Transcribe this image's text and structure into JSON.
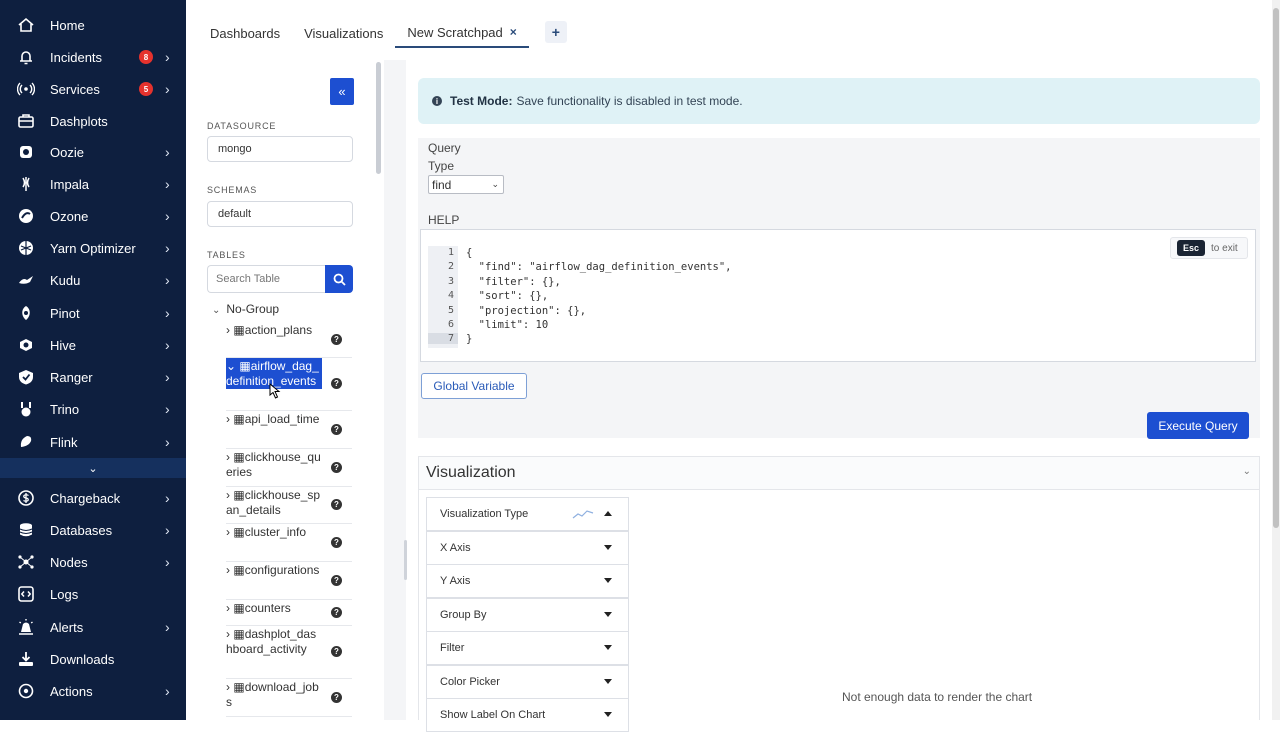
{
  "nav": {
    "items": [
      {
        "label": "Home",
        "icon": "home-icon",
        "badge": "",
        "chevron": false
      },
      {
        "label": "Incidents",
        "icon": "bell-icon",
        "badge": "8",
        "chevron": true
      },
      {
        "label": "Services",
        "icon": "broadcast-icon",
        "badge": "5",
        "chevron": true
      },
      {
        "label": "Dashplots",
        "icon": "briefcase-icon",
        "badge": "",
        "chevron": false
      },
      {
        "label": "Oozie",
        "icon": "oozie-icon",
        "badge": "",
        "chevron": true
      },
      {
        "label": "Impala",
        "icon": "impala-icon",
        "badge": "",
        "chevron": true
      },
      {
        "label": "Ozone",
        "icon": "ozone-icon",
        "badge": "",
        "chevron": true
      },
      {
        "label": "Yarn Optimizer",
        "icon": "yarn-icon",
        "badge": "",
        "chevron": true
      },
      {
        "label": "Kudu",
        "icon": "kudu-icon",
        "badge": "",
        "chevron": true
      },
      {
        "label": "Pinot",
        "icon": "pinot-icon",
        "badge": "",
        "chevron": true
      },
      {
        "label": "Hive",
        "icon": "hive-icon",
        "badge": "",
        "chevron": true
      },
      {
        "label": "Ranger",
        "icon": "ranger-icon",
        "badge": "",
        "chevron": true
      },
      {
        "label": "Trino",
        "icon": "trino-icon",
        "badge": "",
        "chevron": true
      },
      {
        "label": "Flink",
        "icon": "flink-icon",
        "badge": "",
        "chevron": true
      },
      {
        "label": "Chargeback",
        "icon": "dollar-icon",
        "badge": "",
        "chevron": true
      },
      {
        "label": "Databases",
        "icon": "database-icon",
        "badge": "",
        "chevron": true
      },
      {
        "label": "Nodes",
        "icon": "nodes-icon",
        "badge": "",
        "chevron": true
      },
      {
        "label": "Logs",
        "icon": "code-icon",
        "badge": "",
        "chevron": false
      },
      {
        "label": "Alerts",
        "icon": "alert-icon",
        "badge": "",
        "chevron": true
      },
      {
        "label": "Downloads",
        "icon": "download-icon",
        "badge": "",
        "chevron": false
      },
      {
        "label": "Actions",
        "icon": "actions-icon",
        "badge": "",
        "chevron": true
      }
    ],
    "expand_icon": "chevron-down-icon"
  },
  "tabs": {
    "items": [
      "Dashboards",
      "Visualizations",
      "New Scratchpad"
    ],
    "close": "×",
    "add": "+"
  },
  "sidebar": {
    "collapse_glyph": "«",
    "datasource_label": "DATASOURCE",
    "datasource_value": "mongo",
    "schemas_label": "SCHEMAS",
    "schemas_value": "default",
    "tables_label": "TABLES",
    "search_placeholder": "Search Table",
    "group": "No-Group",
    "tables": [
      "action_plans",
      "airflow_dag_definition_events",
      "api_load_time",
      "clickhouse_queries",
      "clickhouse_span_details",
      "cluster_info",
      "configurations",
      "counters",
      "dashplot_dashboard_activity",
      "download_jobs"
    ],
    "selected_table": "airflow_dag_definition_events"
  },
  "banner": {
    "title": "Test Mode:",
    "message": "Save functionality is disabled in test mode."
  },
  "query": {
    "query_label": "Query",
    "type_label": "Type",
    "type_value": "find",
    "help_label": "HELP",
    "esc_key": "Esc",
    "esc_hint": "to exit",
    "line_numbers": [
      "1",
      "2",
      "3",
      "4",
      "5",
      "6",
      "7"
    ],
    "code_lines": [
      "{",
      "  \"find\": \"airflow_dag_definition_events\",",
      "  \"filter\": {},",
      "  \"sort\": {},",
      "  \"projection\": {},",
      "  \"limit\": 10",
      "}"
    ],
    "global_variable_label": "Global Variable",
    "execute_label": "Execute Query"
  },
  "visualization": {
    "title": "Visualization",
    "options": [
      "Visualization Type",
      "X Axis",
      "Y Axis",
      "Group By",
      "Filter",
      "Color Picker",
      "Show Label On Chart"
    ],
    "empty_message": "Not enough data to render the chart"
  },
  "colors": {
    "nav_bg": "#0e1f3f",
    "accent": "#1d4fd1",
    "badge": "#e5322d",
    "banner_bg": "#dff2f6"
  }
}
